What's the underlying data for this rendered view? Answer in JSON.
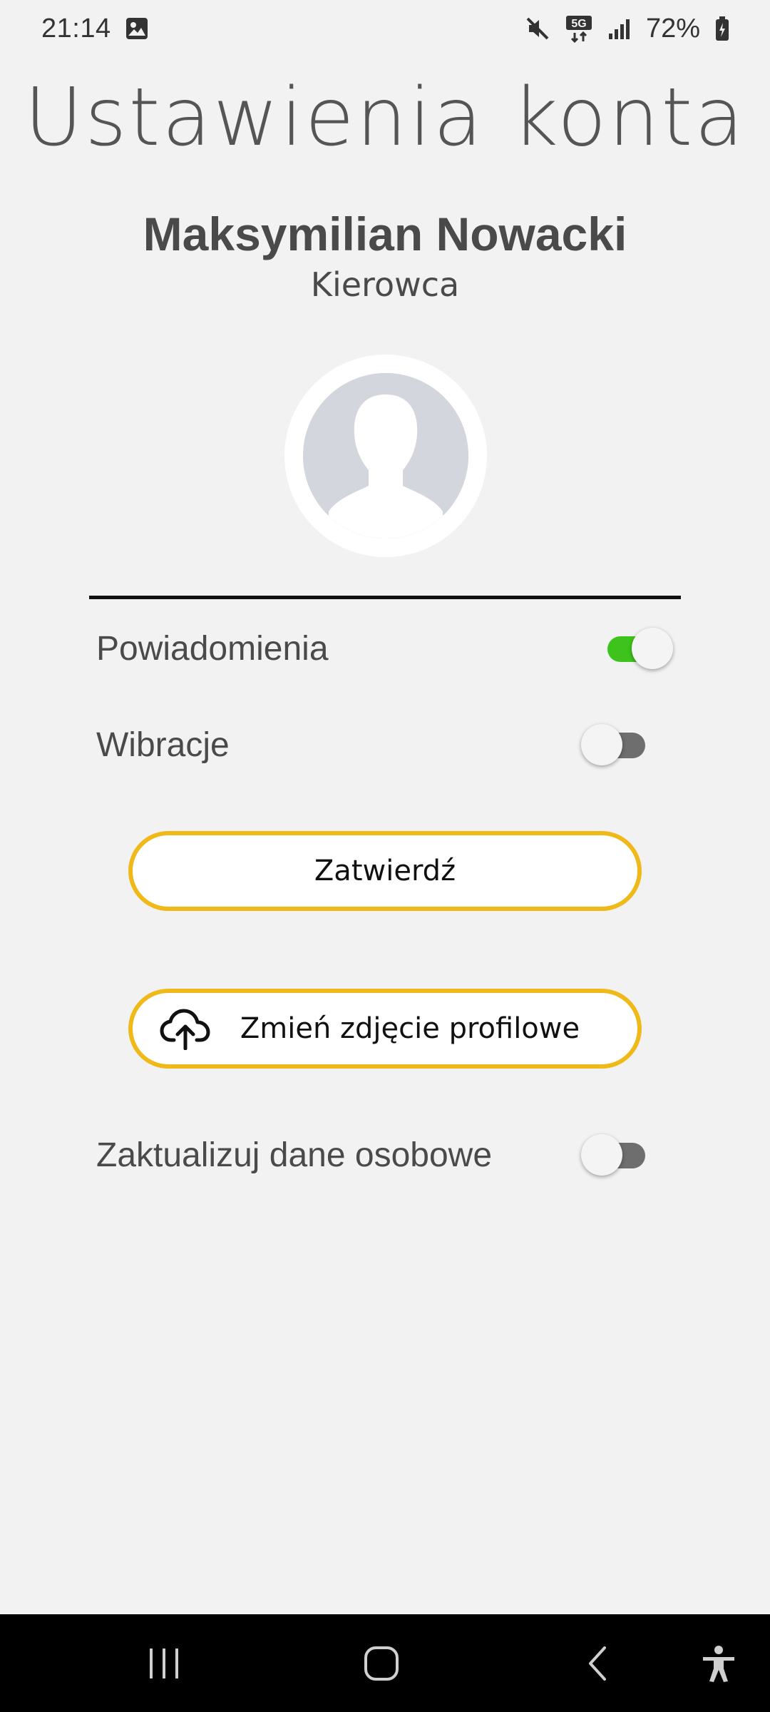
{
  "status_bar": {
    "time": "21:14",
    "battery": "72%",
    "network": "5G",
    "icons": [
      "gallery-icon",
      "mute-icon",
      "5g-icon",
      "signal-icon",
      "battery-icon"
    ]
  },
  "page": {
    "title": "Ustawienia konta"
  },
  "user": {
    "name": "Maksymilian Nowacki",
    "role": "Kierowca"
  },
  "settings": {
    "notifications": {
      "label": "Powiadomienia",
      "enabled": true
    },
    "vibrations": {
      "label": "Wibracje",
      "enabled": false
    },
    "update_personal_data": {
      "label": "Zaktualizuj dane osobowe",
      "enabled": false
    }
  },
  "buttons": {
    "confirm_label": "Zatwierdź",
    "change_photo_label": "Zmień zdjęcie profilowe"
  },
  "colors": {
    "background": "#f2f2f2",
    "accent_border": "#f0b91a",
    "toggle_on": "#3ec31c",
    "toggle_off": "#6e6e6e"
  },
  "nav_bar": {
    "icons": [
      "recent-apps-icon",
      "home-icon",
      "back-icon",
      "accessibility-icon"
    ]
  }
}
